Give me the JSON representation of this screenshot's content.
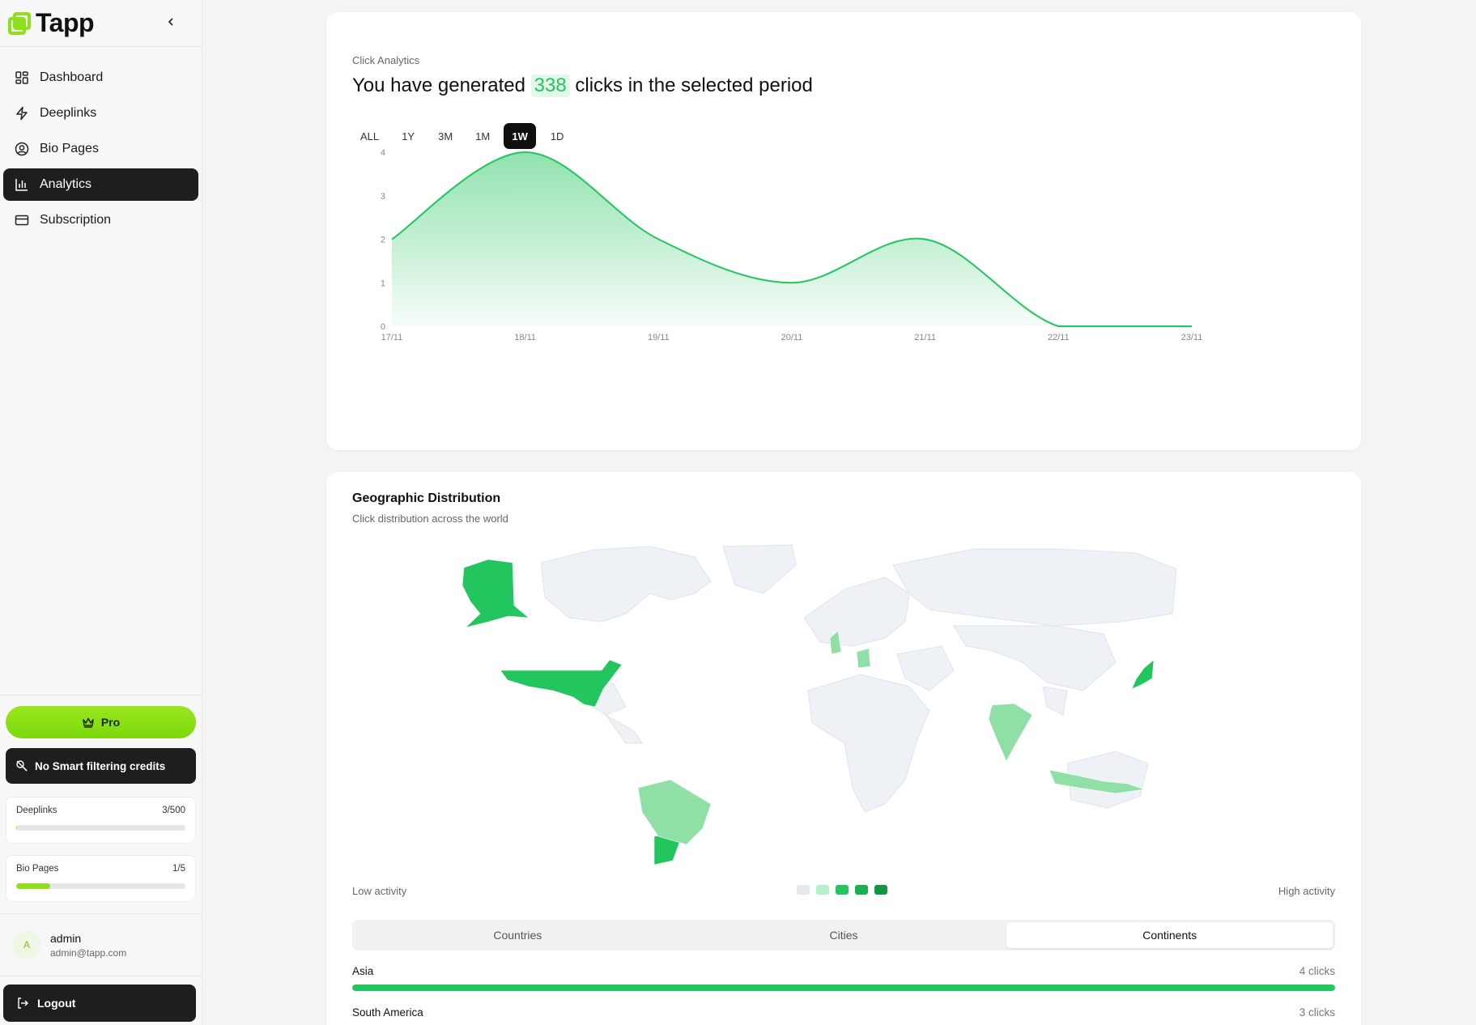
{
  "brand": {
    "name": "Tapp",
    "accent": "#8fe01a"
  },
  "sidebar": {
    "items": [
      {
        "label": "Dashboard",
        "icon": "grid-icon"
      },
      {
        "label": "Deeplinks",
        "icon": "bolt-icon"
      },
      {
        "label": "Bio Pages",
        "icon": "user-circle-icon"
      },
      {
        "label": "Analytics",
        "icon": "bar-chart-icon",
        "active": true
      },
      {
        "label": "Subscription",
        "icon": "credit-card-icon"
      }
    ],
    "pro_label": "Pro",
    "credits_label": "No Smart filtering credits",
    "usage": [
      {
        "label": "Deeplinks",
        "value": "3/500",
        "fraction": 0.006
      },
      {
        "label": "Bio Pages",
        "value": "1/5",
        "fraction": 0.2
      }
    ],
    "user": {
      "initial": "A",
      "name": "admin",
      "email": "admin@tapp.com"
    },
    "logout_label": "Logout"
  },
  "analytics": {
    "eyebrow": "Click Analytics",
    "headline_pre": "You have generated",
    "headline_num": "338",
    "headline_post": "clicks in the selected period",
    "ranges": [
      "ALL",
      "1Y",
      "3M",
      "1M",
      "1W",
      "1D"
    ],
    "active_range": "1W"
  },
  "chart_data": {
    "type": "area",
    "x": [
      "17/11",
      "18/11",
      "19/11",
      "20/11",
      "21/11",
      "22/11",
      "23/11"
    ],
    "values": [
      2,
      4,
      2,
      1,
      2,
      0,
      0
    ],
    "yticks": [
      0,
      1,
      2,
      3,
      4
    ],
    "ylim": [
      0,
      4
    ],
    "color": "#22c55e"
  },
  "geo": {
    "title": "Geographic Distribution",
    "subtitle": "Click distribution across the world",
    "legend_low": "Low activity",
    "legend_high": "High activity",
    "legend_colors": [
      "#e3e8ee",
      "#b9f0cc",
      "#22c55e",
      "#16b24f",
      "#0f9a42"
    ],
    "tabs": [
      "Countries",
      "Cities",
      "Continents"
    ],
    "active_tab": "Continents",
    "rows": [
      {
        "name": "Asia",
        "value": "4 clicks",
        "fraction": 1.0
      },
      {
        "name": "South America",
        "value": "3 clicks",
        "fraction": 0.75
      }
    ]
  }
}
